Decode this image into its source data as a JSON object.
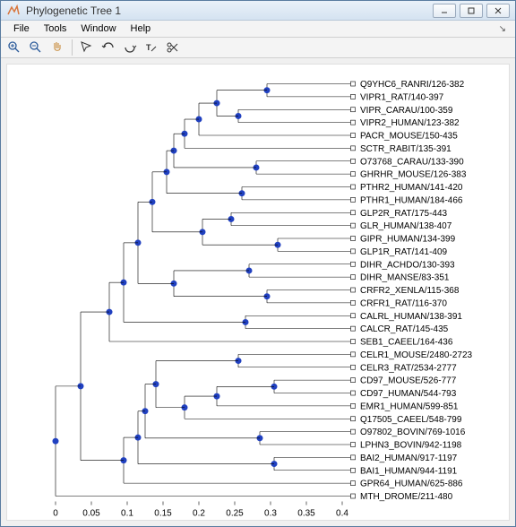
{
  "window": {
    "title": "Phylogenetic Tree 1"
  },
  "menu": {
    "file": "File",
    "tools": "Tools",
    "window": "Window",
    "help": "Help"
  },
  "chart_data": {
    "type": "dendrogram",
    "xlabel": "",
    "ylabel": "",
    "xlim": [
      -0.02,
      0.42
    ],
    "ticks": [
      0,
      0.05,
      0.1,
      0.15,
      0.2,
      0.25,
      0.3,
      0.35,
      0.4
    ],
    "tick_labels": [
      "0",
      "0.05",
      "0.1",
      "0.15",
      "0.2",
      "0.25",
      "0.3",
      "0.35",
      "0.4"
    ],
    "leaf_x": 0.415,
    "leaves": [
      "Q9YHC6_RANRI/126-382",
      "VIPR1_RAT/140-397",
      "VIPR_CARAU/100-359",
      "VIPR2_HUMAN/123-382",
      "PACR_MOUSE/150-435",
      "SCTR_RABIT/135-391",
      "O73768_CARAU/133-390",
      "GHRHR_MOUSE/126-383",
      "PTHR2_HUMAN/141-420",
      "PTHR1_HUMAN/184-466",
      "GLP2R_RAT/175-443",
      "GLR_HUMAN/138-407",
      "GIPR_HUMAN/134-399",
      "GLP1R_RAT/141-409",
      "DIHR_ACHDO/130-393",
      "DIHR_MANSE/83-351",
      "CRFR2_XENLA/115-368",
      "CRFR1_RAT/116-370",
      "CALRL_HUMAN/138-391",
      "CALCR_RAT/145-435",
      "SEB1_CAEEL/164-436",
      "CELR1_MOUSE/2480-2723",
      "CELR3_RAT/2534-2777",
      "CD97_MOUSE/526-777",
      "CD97_HUMAN/544-793",
      "EMR1_HUMAN/599-851",
      "Q17505_CAEEL/548-799",
      "O97802_BOVIN/769-1016",
      "LPHN3_BOVIN/942-1198",
      "BAI2_HUMAN/917-1197",
      "BAI1_HUMAN/944-1191",
      "GPR64_HUMAN/625-886",
      "MTH_DROME/211-480"
    ],
    "internal_nodes": [
      {
        "x": 0.295,
        "children_y": [
          0,
          1
        ]
      },
      {
        "x": 0.255,
        "children_y": [
          2,
          3
        ]
      },
      {
        "x": 0.225,
        "join": [
          0.295,
          0.255
        ],
        "children_y": [
          0.5,
          2.5
        ]
      },
      {
        "x": 0.2,
        "join": [
          0.225,
          0.415
        ],
        "children_y": [
          1.5,
          4
        ]
      },
      {
        "x": 0.18,
        "join": [
          0.2,
          0.415
        ],
        "children_y": [
          2.75,
          5
        ]
      },
      {
        "x": 0.28,
        "children_y": [
          6,
          7
        ]
      },
      {
        "x": 0.165,
        "join": [
          0.18,
          0.28
        ],
        "children_y": [
          3.875,
          6.5
        ]
      },
      {
        "x": 0.26,
        "children_y": [
          8,
          9
        ]
      },
      {
        "x": 0.155,
        "join": [
          0.165,
          0.26
        ],
        "children_y": [
          5.19,
          8.5
        ]
      },
      {
        "x": 0.245,
        "children_y": [
          10,
          11
        ]
      },
      {
        "x": 0.31,
        "children_y": [
          12,
          13
        ]
      },
      {
        "x": 0.205,
        "join": [
          0.245,
          0.31
        ],
        "children_y": [
          10.5,
          12.5
        ]
      },
      {
        "x": 0.135,
        "join": [
          0.155,
          0.205
        ],
        "children_y": [
          6.84,
          11.5
        ]
      },
      {
        "x": 0.27,
        "children_y": [
          14,
          15
        ]
      },
      {
        "x": 0.295,
        "children_y": [
          16,
          17
        ]
      },
      {
        "x": 0.165,
        "join": [
          0.27,
          0.295
        ],
        "children_y": [
          14.5,
          16.5
        ]
      },
      {
        "x": 0.115,
        "join": [
          0.135,
          0.165
        ],
        "children_y": [
          9.17,
          15.5
        ]
      },
      {
        "x": 0.265,
        "children_y": [
          18,
          19
        ]
      },
      {
        "x": 0.095,
        "join": [
          0.115,
          0.265
        ],
        "children_y": [
          12.34,
          18.5
        ]
      },
      {
        "x": 0.075,
        "join": [
          0.095,
          0.415
        ],
        "children_y": [
          15.42,
          20
        ]
      },
      {
        "x": 0.255,
        "children_y": [
          21,
          22
        ]
      },
      {
        "x": 0.305,
        "children_y": [
          23,
          24
        ]
      },
      {
        "x": 0.225,
        "join": [
          0.305,
          0.415
        ],
        "children_y": [
          23.5,
          25
        ]
      },
      {
        "x": 0.18,
        "join": [
          0.225,
          0.415
        ],
        "children_y": [
          24.25,
          26
        ]
      },
      {
        "x": 0.14,
        "join": [
          0.255,
          0.18
        ],
        "children_y": [
          21.5,
          25.13
        ]
      },
      {
        "x": 0.285,
        "children_y": [
          27,
          28
        ]
      },
      {
        "x": 0.125,
        "join": [
          0.14,
          0.285
        ],
        "children_y": [
          23.31,
          27.5
        ]
      },
      {
        "x": 0.305,
        "children_y": [
          29,
          30
        ]
      },
      {
        "x": 0.115,
        "join": [
          0.125,
          0.305
        ],
        "children_y": [
          25.41,
          29.5
        ]
      },
      {
        "x": 0.095,
        "join": [
          0.115,
          0.415
        ],
        "children_y": [
          27.45,
          31
        ]
      },
      {
        "x": 0.035,
        "join": [
          0.075,
          0.095
        ],
        "children_y": [
          17.71,
          29.23
        ]
      },
      {
        "x": 0.0,
        "join": [
          0.035,
          0.415
        ],
        "children_y": [
          23.47,
          32
        ]
      }
    ]
  }
}
